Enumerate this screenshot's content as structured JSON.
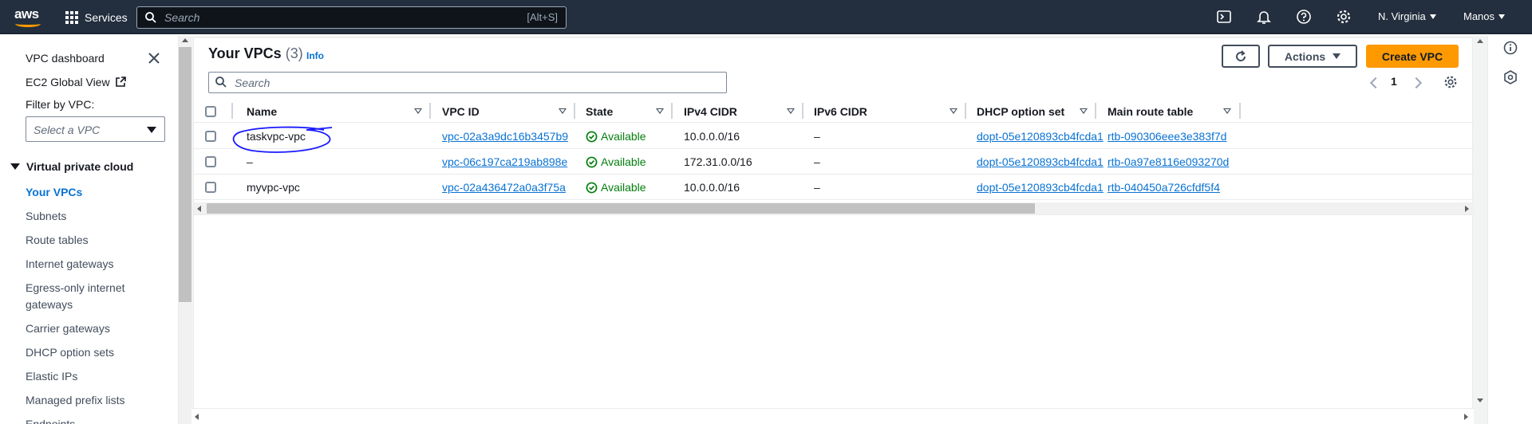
{
  "topnav": {
    "logo": "aws",
    "services_label": "Services",
    "search_placeholder": "Search",
    "search_shortcut": "[Alt+S]",
    "region": "N. Virginia",
    "user": "Manos",
    "icons": [
      "cloudshell-icon",
      "bell-icon",
      "help-icon",
      "gear-icon"
    ]
  },
  "sidebar": {
    "dashboard_label": "VPC dashboard",
    "ec2_global_label": "EC2 Global View",
    "filter_label": "Filter by VPC:",
    "filter_placeholder": "Select a VPC",
    "section_label": "Virtual private cloud",
    "items": [
      {
        "label": "Your VPCs",
        "active": true
      },
      {
        "label": "Subnets"
      },
      {
        "label": "Route tables"
      },
      {
        "label": "Internet gateways"
      },
      {
        "label": "Egress-only internet gateways"
      },
      {
        "label": "Carrier gateways"
      },
      {
        "label": "DHCP option sets"
      },
      {
        "label": "Elastic IPs"
      },
      {
        "label": "Managed prefix lists"
      },
      {
        "label": "Endpoints"
      }
    ]
  },
  "main": {
    "title": "Your VPCs",
    "count": "(3)",
    "info_label": "Info",
    "actions_label": "Actions",
    "create_label": "Create VPC",
    "search_placeholder": "Search",
    "page_number": "1",
    "columns": [
      "Name",
      "VPC ID",
      "State",
      "IPv4 CIDR",
      "IPv6 CIDR",
      "DHCP option set",
      "Main route table"
    ],
    "rows": [
      {
        "name": "taskvpc-vpc",
        "vpc_id": "vpc-02a3a9dc16b3457b9",
        "state": "Available",
        "ipv4": "10.0.0.0/16",
        "ipv6": "–",
        "dhcp": "dopt-05e120893cb4fcda1",
        "route": "rtb-090306eee3e383f7d"
      },
      {
        "name": "–",
        "vpc_id": "vpc-06c197ca219ab898e",
        "state": "Available",
        "ipv4": "172.31.0.0/16",
        "ipv6": "–",
        "dhcp": "dopt-05e120893cb4fcda1",
        "route": "rtb-0a97e8116e093270d"
      },
      {
        "name": "myvpc-vpc",
        "vpc_id": "vpc-02a436472a0a3f75a",
        "state": "Available",
        "ipv4": "10.0.0.0/16",
        "ipv6": "–",
        "dhcp": "dopt-05e120893cb4fcda1",
        "route": "rtb-040450a726cfdf5f4"
      }
    ]
  },
  "colors": {
    "nav_bg": "#232f3e",
    "accent": "#ff9900",
    "link": "#0972d3",
    "success": "#037f0c",
    "annotation": "#1a1aff"
  }
}
